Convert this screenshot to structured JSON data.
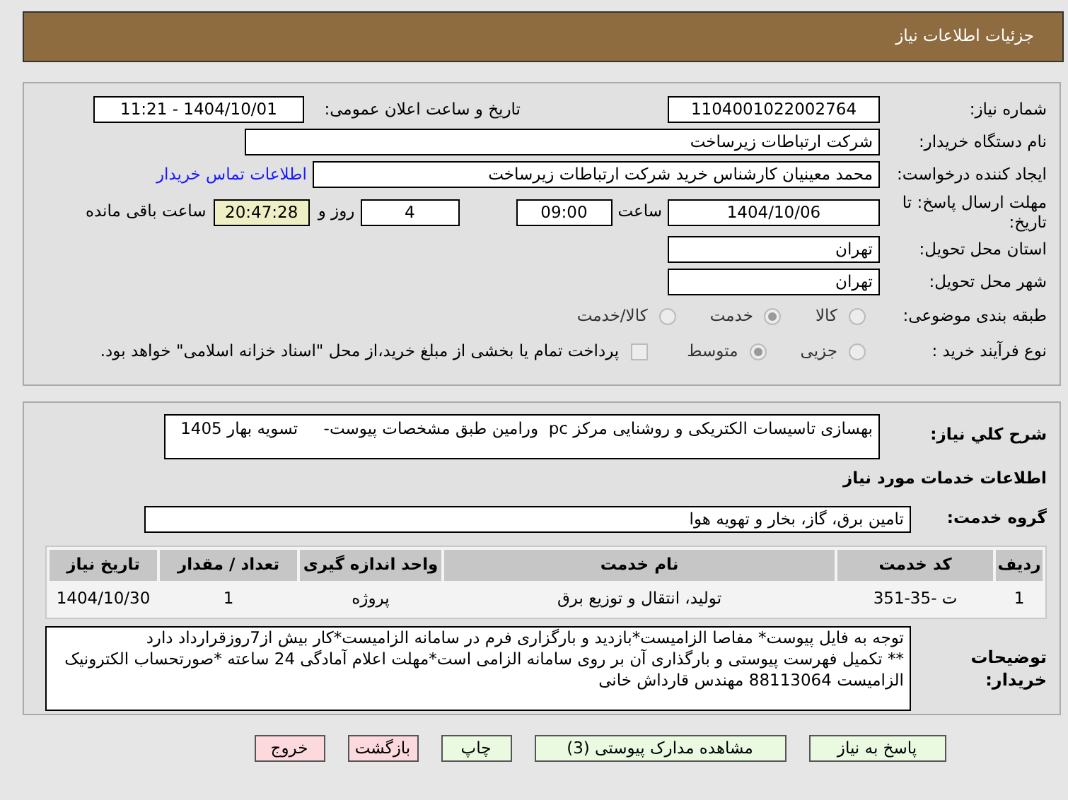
{
  "header": {
    "title": "جزئیات اطلاعات نیاز"
  },
  "need_number": {
    "label": "شماره نیاز:",
    "value": "1104001022002764"
  },
  "announce_date": {
    "label": "تاریخ و ساعت اعلان عمومی:",
    "value": "1404/10/01 - 11:21"
  },
  "buyer_org": {
    "label": "نام دستگاه خریدار:",
    "value": "شرکت ارتباطات زیرساخت"
  },
  "requester": {
    "label": "ایجاد کننده درخواست:",
    "value": "محمد معینیان کارشناس خرید شرکت ارتباطات زیرساخت",
    "link": "اطلاعات تماس خریدار"
  },
  "deadline": {
    "label": "مهلت ارسال پاسخ: تا تاریخ:",
    "date": "1404/10/06",
    "time_label": "ساعت",
    "time": "09:00",
    "days": "4",
    "days_label": "روز و",
    "remaining": "20:47:28",
    "remaining_label": "ساعت باقی مانده"
  },
  "province": {
    "label": "استان محل تحویل:",
    "value": "تهران"
  },
  "city": {
    "label": "شهر محل تحویل:",
    "value": "تهران"
  },
  "category": {
    "label": "طبقه بندی موضوعی:",
    "options": [
      {
        "label": "کالا",
        "selected": false
      },
      {
        "label": "خدمت",
        "selected": true
      },
      {
        "label": "کالا/خدمت",
        "selected": false
      }
    ]
  },
  "process": {
    "label": "نوع فرآیند خرید :",
    "options": [
      {
        "label": "جزیی",
        "selected": false
      },
      {
        "label": "متوسط",
        "selected": true
      }
    ],
    "payment": {
      "label": "پرداخت تمام یا بخشی از مبلغ خرید،از محل \"اسناد خزانه اسلامی\" خواهد بود.",
      "checked": false
    }
  },
  "summary": {
    "label": "شرح کلي نیاز:",
    "value": "بهسازی تاسیسات الکتریکی و روشنایی مرکز pc  ورامین طبق مشخصات پیوست-     تسویه بهار 1405"
  },
  "services_title": "اطلاعات خدمات مورد نیاز",
  "service_group": {
    "label": "گروه خدمت:",
    "value": "تامین برق، گاز، بخار و تهویه هوا"
  },
  "table": {
    "columns": [
      "ردیف",
      "کد خدمت",
      "نام خدمت",
      "واحد اندازه گیری",
      "تعداد / مقدار",
      "تاریخ نیاز"
    ],
    "rows": [
      [
        "1",
        "ت -35-351",
        "تولید، انتقال و توزیع برق",
        "پروژه",
        "1",
        "1404/10/30"
      ]
    ]
  },
  "buyer_notes": {
    "label": "توضیحات خریدار:",
    "value": "توجه به فایل پیوست* مفاصا الزامیست*بازدید و بارگزاری فرم در سامانه الزامیست*کار بیش از7روزقرارداد دارد\n** تکمیل فهرست پیوستی و بارگذاری آن بر روی سامانه الزامی است*مهلت اعلام آمادگی 24 ساعته *صورتحساب الکترونیک الزامیست 88113064 مهندس قارداش خانی"
  },
  "buttons": [
    {
      "label": "پاسخ به نیاز",
      "kind": "go"
    },
    {
      "label": "مشاهده مدارک پیوستی (3)",
      "kind": "go"
    },
    {
      "label": "چاپ",
      "kind": "go"
    },
    {
      "label": "بازگشت",
      "kind": "back"
    },
    {
      "label": "خروج",
      "kind": "back"
    }
  ]
}
